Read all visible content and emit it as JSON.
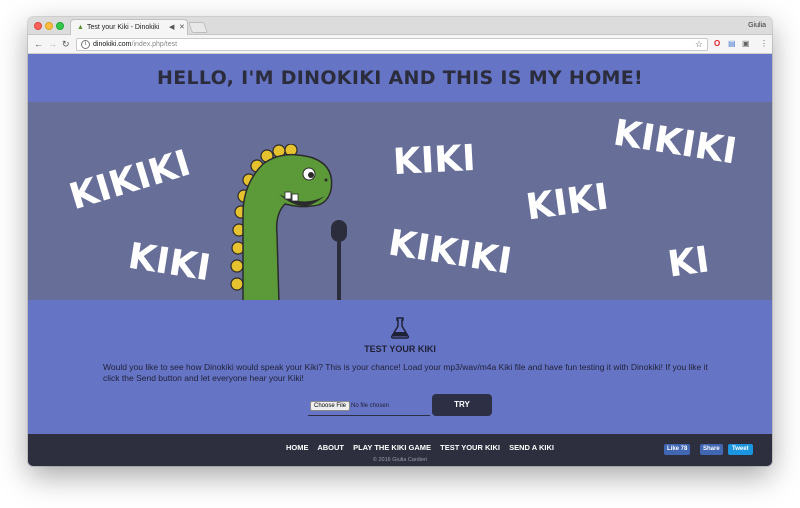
{
  "browser": {
    "tab_title": "Test your Kiki - Dinokiki",
    "profile_name": "Giulia",
    "url_host": "dinokiki.com",
    "url_path": "/index.php/test"
  },
  "page": {
    "headline": "HELLO, I'M DINOKIKI AND THIS IS MY HOME!",
    "banner_words": [
      "KIKIKI",
      "KIKI",
      "KIKI",
      "KIKIKI",
      "KIKI",
      "KIKIKI",
      "KI"
    ]
  },
  "test": {
    "title": "TEST YOUR KIKI",
    "description": "Would you like to see how Dinokiki would speak your Kiki? This is your chance! Load your mp3/wav/m4a Kiki file and have fun testing it with Dinokiki! If you like it click the Send button and let everyone hear your Kiki!",
    "choose_file_label": "Choose File",
    "no_file_text": "No file chosen",
    "try_label": "TRY"
  },
  "footer": {
    "nav": [
      "HOME",
      "ABOUT",
      "PLAY THE KIKI GAME",
      "TEST YOUR KIKI",
      "SEND A KIKI"
    ],
    "copyright": "© 2016 Giulia Cardieri",
    "fb_like": "Like 78",
    "fb_share": "Share",
    "tweet": "Tweet"
  },
  "colors": {
    "page_bg": "#6674c6",
    "banner_bg": "#676e98",
    "footer_bg": "#2d2f3e",
    "dino_green": "#5c9a39",
    "dino_spikes": "#e6c22e"
  }
}
